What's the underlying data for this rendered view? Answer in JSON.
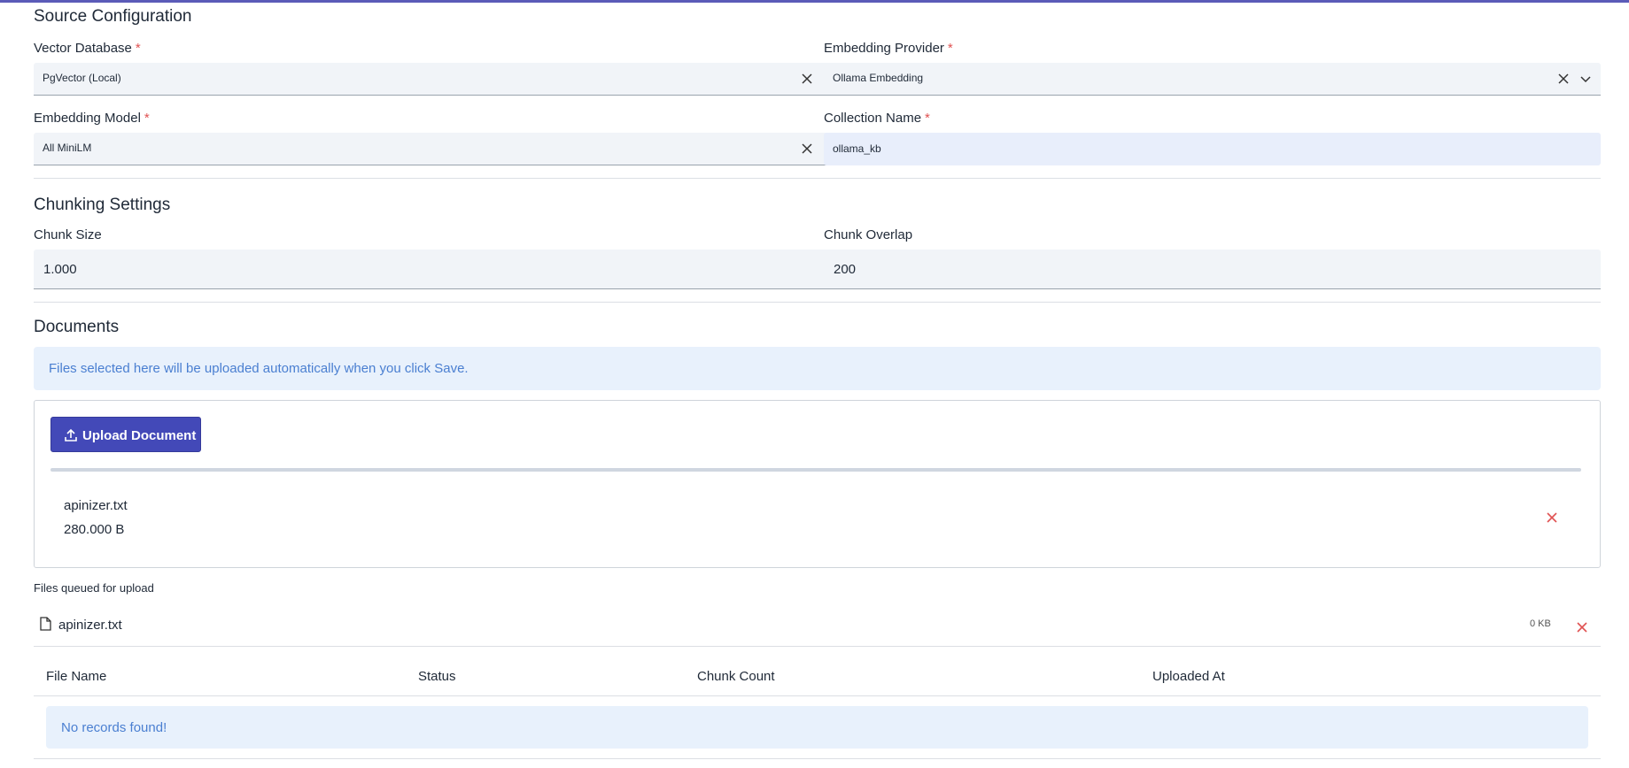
{
  "source_config": {
    "title": "Source Configuration",
    "vector_db": {
      "label": "Vector Database",
      "value": "PgVector (Local)"
    },
    "embedding_provider": {
      "label": "Embedding Provider",
      "value": "Ollama Embedding"
    },
    "embedding_model": {
      "label": "Embedding Model",
      "value": "All MiniLM"
    },
    "collection_name": {
      "label": "Collection Name",
      "value": "ollama_kb"
    },
    "required_mark": "*"
  },
  "chunking": {
    "title": "Chunking Settings",
    "chunk_size": {
      "label": "Chunk Size",
      "value": "1.000"
    },
    "chunk_overlap": {
      "label": "Chunk Overlap",
      "value": "200"
    }
  },
  "documents": {
    "title": "Documents",
    "info": "Files selected here will be uploaded automatically when you click Save.",
    "upload_button": "Upload Document",
    "selected_file": {
      "name": "apinizer.txt",
      "size": "280.000 B"
    },
    "queued_title": "Files queued for upload",
    "queued": [
      {
        "name": "apinizer.txt",
        "size": "0 KB"
      }
    ],
    "table": {
      "columns": [
        "File Name",
        "Status",
        "Chunk Count",
        "Uploaded At"
      ],
      "empty": "No records found!"
    }
  },
  "colors": {
    "accent": "#4349b8",
    "danger": "#e05252",
    "info_bg": "#e8f1fc",
    "info_text": "#4a7fd1"
  }
}
